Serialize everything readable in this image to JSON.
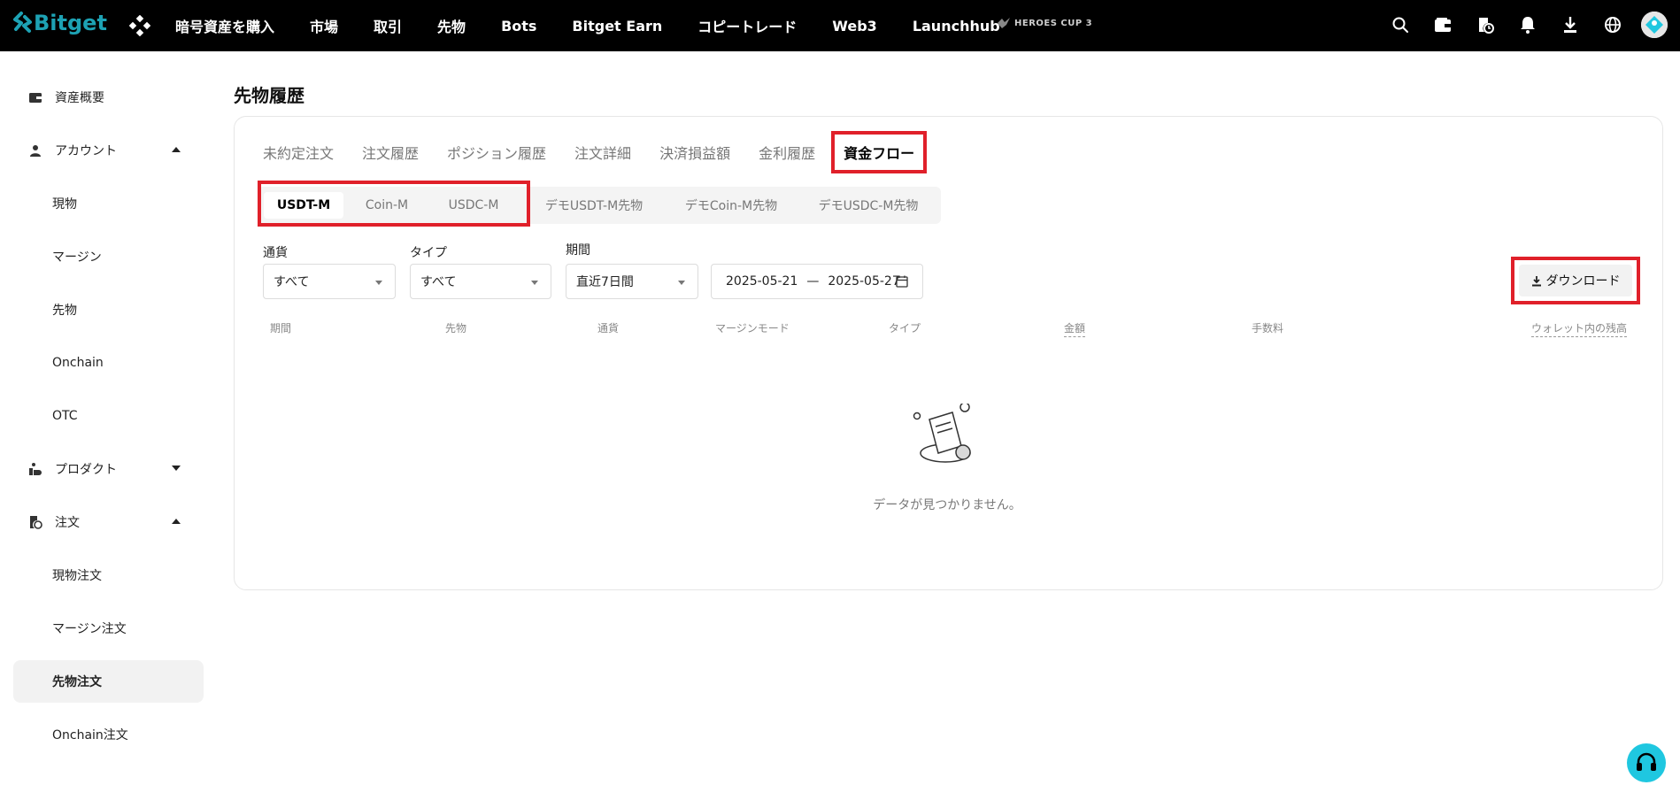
{
  "brand": {
    "name": "Bitget",
    "accent": "#1da2b4",
    "highlight": "#e0202a"
  },
  "nav": {
    "items": [
      "暗号資産を購入",
      "市場",
      "取引",
      "先物",
      "Bots",
      "Bitget Earn",
      "コピートレード",
      "Web3",
      "Launchhub"
    ],
    "promo": "HEROES CUP 3"
  },
  "sidebar": {
    "items": [
      {
        "label": "資産概要",
        "icon": "wallet-icon"
      },
      {
        "label": "アカウント",
        "icon": "user-icon",
        "caret": "up"
      },
      {
        "label": "現物"
      },
      {
        "label": "マージン"
      },
      {
        "label": "先物"
      },
      {
        "label": "Onchain"
      },
      {
        "label": "OTC"
      },
      {
        "label": "プロダクト",
        "icon": "product-icon",
        "caret": "down"
      },
      {
        "label": "注文",
        "icon": "order-icon",
        "caret": "up"
      },
      {
        "label": "現物注文"
      },
      {
        "label": "マージン注文"
      },
      {
        "label": "先物注文",
        "active": true
      },
      {
        "label": "Onchain注文"
      }
    ]
  },
  "page": {
    "title": "先物履歴"
  },
  "tabs": [
    "未約定注文",
    "注文履歴",
    "ポジション履歴",
    "注文詳細",
    "決済損益額",
    "金利履歴",
    "資金フロー"
  ],
  "active_tab": "資金フロー",
  "segments": [
    "USDT-M",
    "Coin-M",
    "USDC-M",
    "デモUSDT-M先物",
    "デモCoin-M先物",
    "デモUSDC-M先物"
  ],
  "active_segment": "USDT-M",
  "filters": {
    "currency": {
      "label": "通貨",
      "value": "すべて"
    },
    "type": {
      "label": "タイプ",
      "value": "すべて"
    },
    "period": {
      "label": "期間",
      "value": "直近7日間"
    },
    "date_start": "2025-05-21",
    "date_sep": "—",
    "date_end": "2025-05-27"
  },
  "download_label": "ダウンロード",
  "table": {
    "headers": [
      "期間",
      "先物",
      "通貨",
      "マージンモード",
      "タイプ",
      "金額",
      "手数料",
      "ウォレット内の残高"
    ]
  },
  "empty_text": "データが見つかりません。"
}
